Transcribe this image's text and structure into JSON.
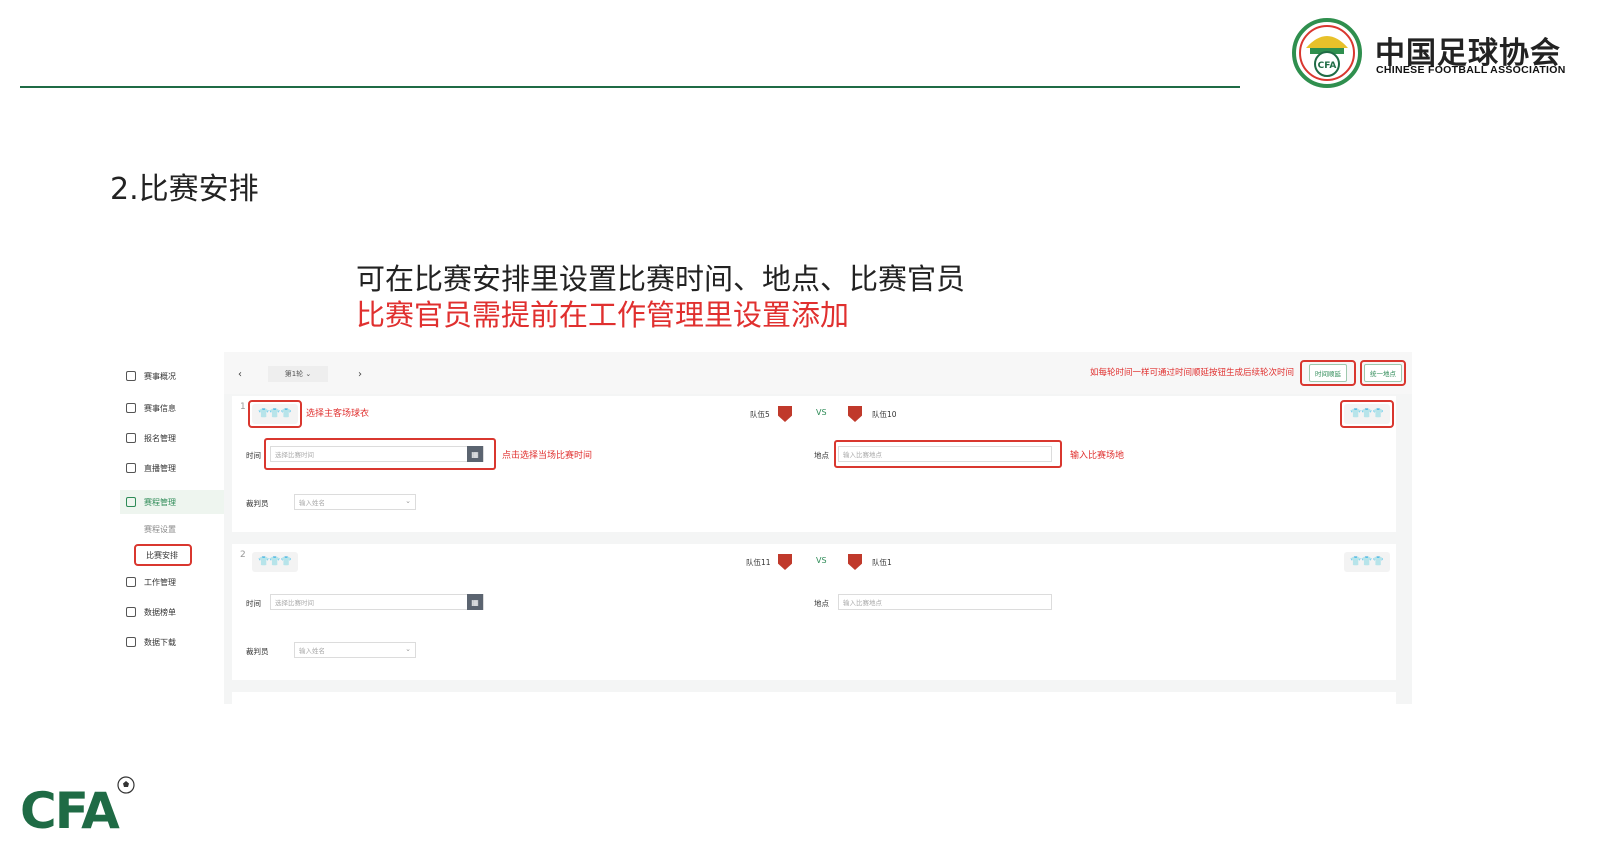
{
  "header": {
    "org_name_cn": "中国足球协会",
    "org_name_en": "CHINESE FOOTBALL ASSOCIATION",
    "badge_text": "CFA"
  },
  "section": {
    "title": "2.比赛安排",
    "description": "可在比赛安排里设置比赛时间、地点、比赛官员",
    "description_red": "比赛官员需提前在工作管理里设置添加"
  },
  "sidebar": {
    "items": [
      {
        "label": "赛事概况"
      },
      {
        "label": "赛事信息"
      },
      {
        "label": "报名管理"
      },
      {
        "label": "直播管理"
      },
      {
        "label": "赛程管理"
      },
      {
        "label": "工作管理"
      },
      {
        "label": "数据榜单"
      },
      {
        "label": "数据下载"
      }
    ],
    "subitems": [
      {
        "label": "赛程设置"
      },
      {
        "label": "比赛安排"
      }
    ]
  },
  "toolbar": {
    "prev": "‹",
    "round": "第1轮",
    "next": "›",
    "hint": "如每轮时间一样可通过时间顺延按钮生成后续轮次时间",
    "btn_time": "时间顺延",
    "btn_place": "统一地点"
  },
  "matches": [
    {
      "index": "1",
      "home": "队伍5",
      "away": "队伍10",
      "vs": "VS",
      "time_label": "时间",
      "time_placeholder": "选择比赛时间",
      "place_label": "地点",
      "place_placeholder": "输入比赛地点",
      "referee_label": "裁判员",
      "referee_placeholder": "输入姓名",
      "note_shirt": "选择主客场球衣",
      "note_time": "点击选择当场比赛时间",
      "note_place": "输入比赛场地"
    },
    {
      "index": "2",
      "home": "队伍11",
      "away": "队伍1",
      "vs": "VS",
      "time_label": "时间",
      "time_placeholder": "选择比赛时间",
      "place_label": "地点",
      "place_placeholder": "输入比赛地点",
      "referee_label": "裁判员",
      "referee_placeholder": "输入姓名"
    }
  ],
  "footer": {
    "logo_text": "CFA"
  },
  "colors": {
    "brand_green": "#1f6b45",
    "accent_red": "#e0302f",
    "highlight_border": "#d9372f"
  }
}
